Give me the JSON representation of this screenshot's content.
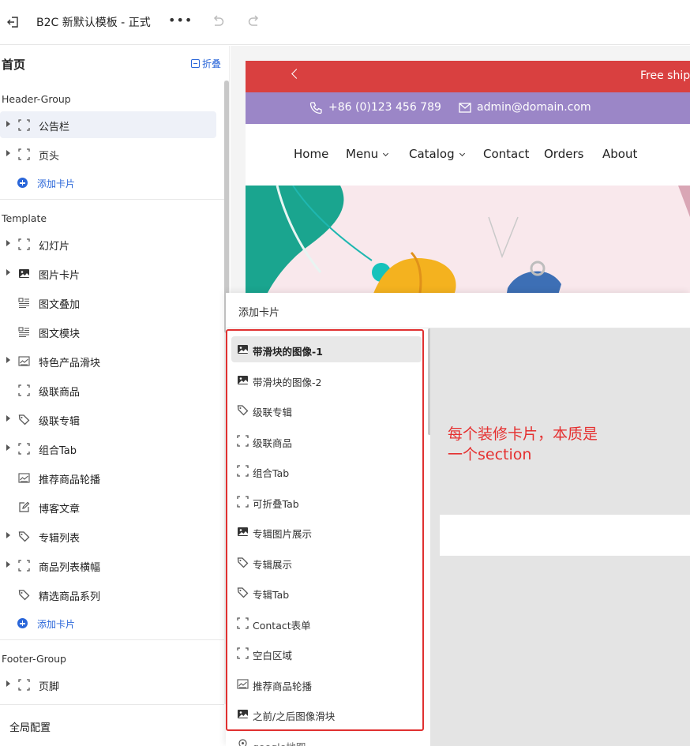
{
  "topbar": {
    "title": "B2C 新默认模板 - 正式",
    "more": "•••",
    "exit_icon": "exit-icon",
    "undo_icon": "undo-icon",
    "redo_icon": "redo-icon"
  },
  "sidebar": {
    "page": "首页",
    "collapse_label": "折叠",
    "header_group": {
      "label": "Header-Group",
      "items": [
        {
          "label": "公告栏",
          "icon": "section-icon",
          "expandable": true,
          "active": true
        },
        {
          "label": "页头",
          "icon": "section-icon",
          "expandable": true
        }
      ],
      "add_label": "添加卡片"
    },
    "template_group": {
      "label": "Template",
      "items": [
        {
          "label": "幻灯片",
          "icon": "section-icon",
          "expandable": true
        },
        {
          "label": "图片卡片",
          "icon": "image-icon",
          "expandable": true
        },
        {
          "label": "图文叠加",
          "icon": "text-image-icon",
          "expandable": false
        },
        {
          "label": "图文模块",
          "icon": "text-image-icon",
          "expandable": false
        },
        {
          "label": "特色产品滑块",
          "icon": "slider-icon",
          "expandable": true
        },
        {
          "label": "级联商品",
          "icon": "section-icon",
          "expandable": false
        },
        {
          "label": "级联专辑",
          "icon": "tag-icon",
          "expandable": true
        },
        {
          "label": "组合Tab",
          "icon": "section-icon",
          "expandable": true
        },
        {
          "label": "推荐商品轮播",
          "icon": "slider-icon",
          "expandable": false
        },
        {
          "label": "博客文章",
          "icon": "edit-icon",
          "expandable": false
        },
        {
          "label": "专辑列表",
          "icon": "tag-icon",
          "expandable": true
        },
        {
          "label": "商品列表横幅",
          "icon": "section-icon",
          "expandable": true
        },
        {
          "label": "精选商品系列",
          "icon": "tag-icon",
          "expandable": false
        }
      ],
      "add_label": "添加卡片"
    },
    "footer_group": {
      "label": "Footer-Group",
      "items": [
        {
          "label": "页脚",
          "icon": "section-icon",
          "expandable": true
        }
      ]
    },
    "global_label": "全局配置"
  },
  "preview": {
    "promo_text": "Free ship",
    "phone": "+86 (0)123 456 789",
    "email": "admin@domain.com",
    "nav": [
      "Home",
      "Menu",
      "Catalog",
      "Contact",
      "Orders",
      "About"
    ]
  },
  "add_panel": {
    "title": "添加卡片",
    "cards": [
      {
        "label": "带滑块的图像-1",
        "icon": "image-icon",
        "selected": true
      },
      {
        "label": "带滑块的图像-2",
        "icon": "image-icon"
      },
      {
        "label": "级联专辑",
        "icon": "tag-icon"
      },
      {
        "label": "级联商品",
        "icon": "section-icon"
      },
      {
        "label": "组合Tab",
        "icon": "section-icon"
      },
      {
        "label": "可折叠Tab",
        "icon": "section-icon"
      },
      {
        "label": "专辑图片展示",
        "icon": "image-icon"
      },
      {
        "label": "专辑展示",
        "icon": "tag-icon"
      },
      {
        "label": "专辑Tab",
        "icon": "tag-icon"
      },
      {
        "label": "Contact表单",
        "icon": "section-icon"
      },
      {
        "label": "空白区域",
        "icon": "section-icon"
      },
      {
        "label": "推荐商品轮播",
        "icon": "slider-icon"
      },
      {
        "label": "之前/之后图像滑块",
        "icon": "image-icon"
      },
      {
        "label": "google地图",
        "icon": "map-pin-icon"
      }
    ]
  },
  "annotation": {
    "line1": "每个装修卡片，本质是",
    "line2": "一个section",
    "color": "#e53030"
  },
  "colors": {
    "accent": "#2a66d9",
    "promo_bar": "#d94040",
    "contact_bar": "#9b86c7",
    "highlight": "#e03030"
  }
}
